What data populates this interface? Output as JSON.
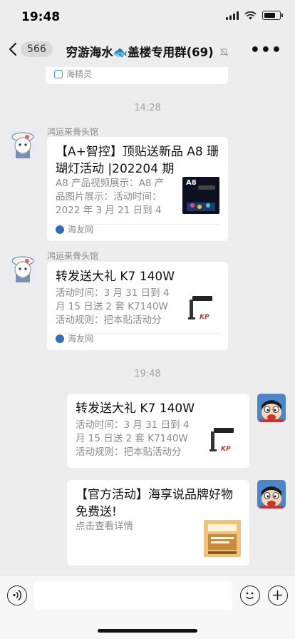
{
  "status_bar": {
    "time": "19:48"
  },
  "nav": {
    "unread_count": "566",
    "title": "穷游海水🐟盖楼专用群(69)",
    "more_label": "•••"
  },
  "messages": {
    "partial_card_source": "海精灵",
    "time_1": "14:28",
    "msg1": {
      "sender": "鸿运来骨头馆",
      "title": "【A+智控】顶贴送新品 A8 珊瑚灯活动 |202204 期",
      "desc": "A8 产品视频展示：A8 产品图片展示：活动时间：2022 年 3 月 21 日到 4 月 2…",
      "source": "海友网",
      "thumb_text": "A8"
    },
    "msg2": {
      "sender": "鸿运来骨头馆",
      "title": "转发送大礼 K7 140W",
      "desc": "活动时间：3 月 31 日到 4 月 15 日送 2 套 K7140W 活动规则：把本贴活动分享…",
      "source": "海友网"
    },
    "time_2": "19:48",
    "msg3": {
      "title": "转发送大礼 K7 140W",
      "desc": "活动时间：3 月 31 日到 4 月 15 日送 2 套 K7140W 活动规则：把本贴活动分享…"
    },
    "msg4": {
      "title": "【官方活动】海享说品牌好物免费送!",
      "desc": "点击查看详情"
    }
  },
  "colors": {
    "background": "#ededed",
    "bubble": "#ffffff",
    "muted_text": "#8b8b8b",
    "timestamp": "#a3a3a3"
  },
  "icons": [
    "wifi-icon",
    "signal-icon",
    "battery-icon",
    "back-chevron-icon",
    "mute-bell-icon",
    "more-icon",
    "voice-icon",
    "emoji-icon",
    "plus-icon"
  ]
}
